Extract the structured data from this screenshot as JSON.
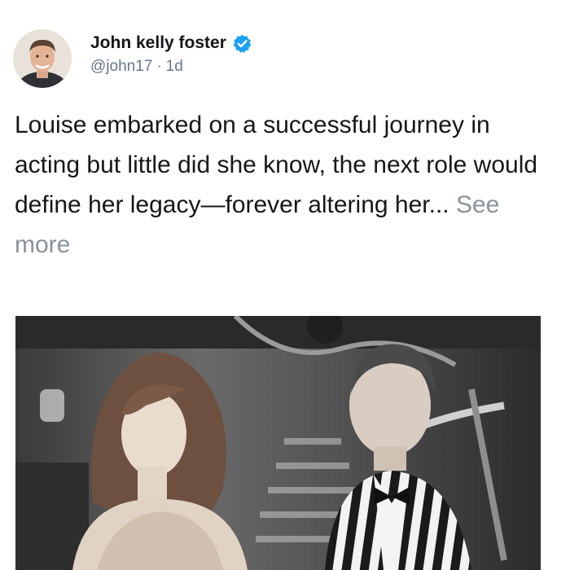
{
  "user": {
    "display_name": "John kelly foster",
    "handle": "@john17",
    "separator": "·",
    "time_ago": "1d",
    "verified": true
  },
  "tweet": {
    "text": "Louise embarked on a successful journey in acting but little did she know, the next role would define her legacy—forever altering her... ",
    "see_more_label": "See more"
  },
  "colors": {
    "text": "#14171a",
    "muted": "#657786",
    "verified_badge": "#1da1f2",
    "see_more": "#8a9299"
  },
  "icons": {
    "verified": "verified-badge-icon"
  }
}
